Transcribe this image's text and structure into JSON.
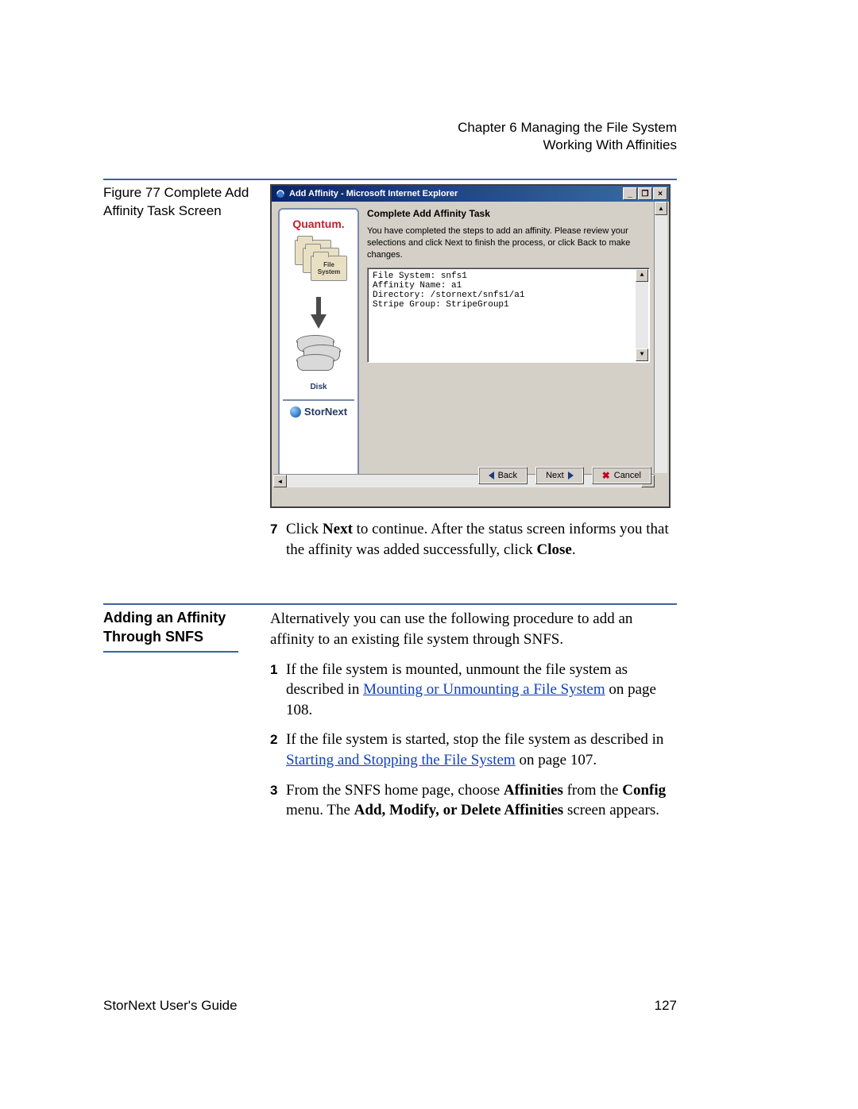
{
  "header": {
    "chapter_line": "Chapter 6  Managing the File System",
    "section_line": "Working With Affinities"
  },
  "figure": {
    "label": "Figure 77  Complete Add Affinity Task Screen"
  },
  "ie_window": {
    "title": "Add Affinity - Microsoft Internet Explorer",
    "min_label": "_",
    "restore_label": "❐",
    "close_label": "×"
  },
  "wizard": {
    "brand": "Quantum.",
    "fs_label": "File System",
    "disk_label": "Disk",
    "sn_label": "StorNext",
    "title": "Complete Add Affinity Task",
    "intro": "You have completed the steps to add an affinity. Please review your selections and click Next to finish the process, or click Back to make changes.",
    "summary_lines": "File System: snfs1\nAffinity Name: a1\nDirectory: /stornext/snfs1/a1\nStripe Group: StripeGroup1",
    "back_label": "Back",
    "next_label": "Next",
    "cancel_label": "Cancel"
  },
  "step7": {
    "num": "7",
    "pre": "Click ",
    "b1": "Next",
    "mid": " to continue. After the status screen informs you that the affinity was added successfully, click ",
    "b2": "Close",
    "post": "."
  },
  "section2": {
    "heading": "Adding an Affinity Through SNFS",
    "intro": "Alternatively you can use the following procedure to add an affinity to an existing file system through SNFS.",
    "s1": {
      "num": "1",
      "pre": "If the file system is mounted, unmount the file system as described in ",
      "link": "Mounting or Unmounting a File System",
      "post": " on page  108."
    },
    "s2": {
      "num": "2",
      "pre": "If the file system is started, stop the file system as described in ",
      "link": "Starting and Stopping the File System",
      "post": " on page  107."
    },
    "s3": {
      "num": "3",
      "pre": "From the SNFS home page, choose ",
      "b1": "Affinities",
      "mid1": " from the ",
      "b2": "Config",
      "mid2": " menu. The ",
      "b3": "Add, Modify, or Delete Affinities",
      "post": " screen appears."
    }
  },
  "footer": {
    "left": "StorNext User's Guide",
    "right": "127"
  }
}
